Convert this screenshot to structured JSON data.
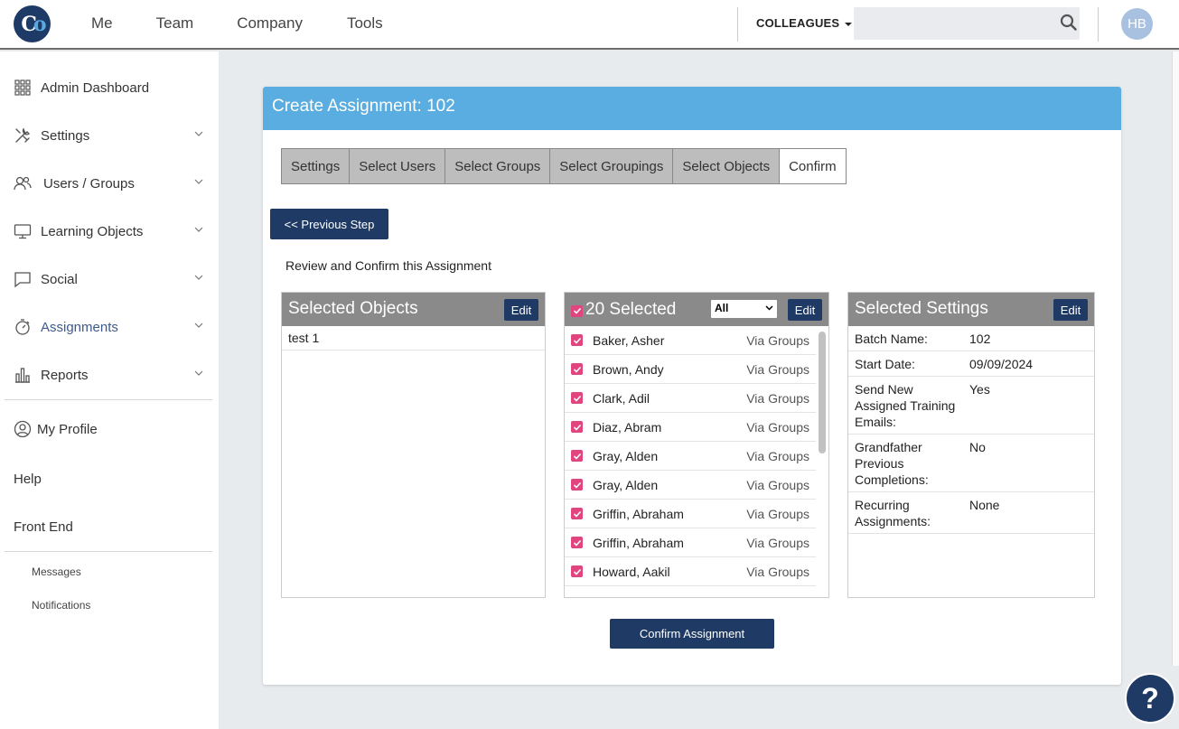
{
  "header": {
    "nav": [
      "Me",
      "Team",
      "Company",
      "Tools"
    ],
    "colleagues_label": "COLLEAGUES",
    "search_placeholder": "",
    "avatar_initials": "HB"
  },
  "sidebar": {
    "items": [
      {
        "label": "Admin Dashboard",
        "icon": "grid-icon"
      },
      {
        "label": "Settings",
        "icon": "tools-icon"
      },
      {
        "label": "Users / Groups",
        "icon": "users-icon"
      },
      {
        "label": "Learning Objects",
        "icon": "monitor-icon"
      },
      {
        "label": "Social",
        "icon": "chat-icon"
      },
      {
        "label": "Assignments",
        "icon": "stopwatch-icon"
      },
      {
        "label": "Reports",
        "icon": "bar-chart-icon"
      }
    ],
    "links": [
      {
        "label": "My Profile",
        "icon": "user-circle-icon"
      },
      {
        "label": "Help"
      },
      {
        "label": "Front End"
      }
    ],
    "sub_links": [
      "Messages",
      "Notifications"
    ]
  },
  "panel": {
    "title": "Create Assignment: 102",
    "tabs": [
      "Settings",
      "Select Users",
      "Select Groups",
      "Select Groupings",
      "Select Objects",
      "Confirm"
    ],
    "prev_button": "<< Previous Step",
    "review_text": "Review and Confirm this Assignment",
    "edit_label": "Edit",
    "confirm_button": "Confirm Assignment"
  },
  "objects": {
    "title": "Selected Objects",
    "items": [
      "test 1"
    ]
  },
  "users": {
    "title": "20 Selected",
    "filter_value": "All",
    "rows": [
      {
        "name": "Baker, Asher",
        "via": "Via Groups"
      },
      {
        "name": "Brown, Andy",
        "via": "Via Groups"
      },
      {
        "name": "Clark, Adil",
        "via": "Via Groups"
      },
      {
        "name": "Diaz, Abram",
        "via": "Via Groups"
      },
      {
        "name": "Gray, Alden",
        "via": "Via Groups"
      },
      {
        "name": "Gray, Alden",
        "via": "Via Groups"
      },
      {
        "name": "Griffin, Abraham",
        "via": "Via Groups"
      },
      {
        "name": "Griffin, Abraham",
        "via": "Via Groups"
      },
      {
        "name": "Howard, Aakil",
        "via": "Via Groups"
      }
    ]
  },
  "settings": {
    "title": "Selected Settings",
    "rows": [
      {
        "key": "Batch Name:",
        "value": "102"
      },
      {
        "key": "Start Date:",
        "value": "09/09/2024"
      },
      {
        "key": "Send New Assigned Training Emails:",
        "value": "Yes"
      },
      {
        "key": "Grandfather Previous Completions:",
        "value": "No"
      },
      {
        "key": "Recurring Assignments:",
        "value": "None"
      }
    ]
  },
  "colors": {
    "header_blue": "#5aade0",
    "navy": "#1f3a64",
    "checkbox_pink": "#e0457f"
  }
}
